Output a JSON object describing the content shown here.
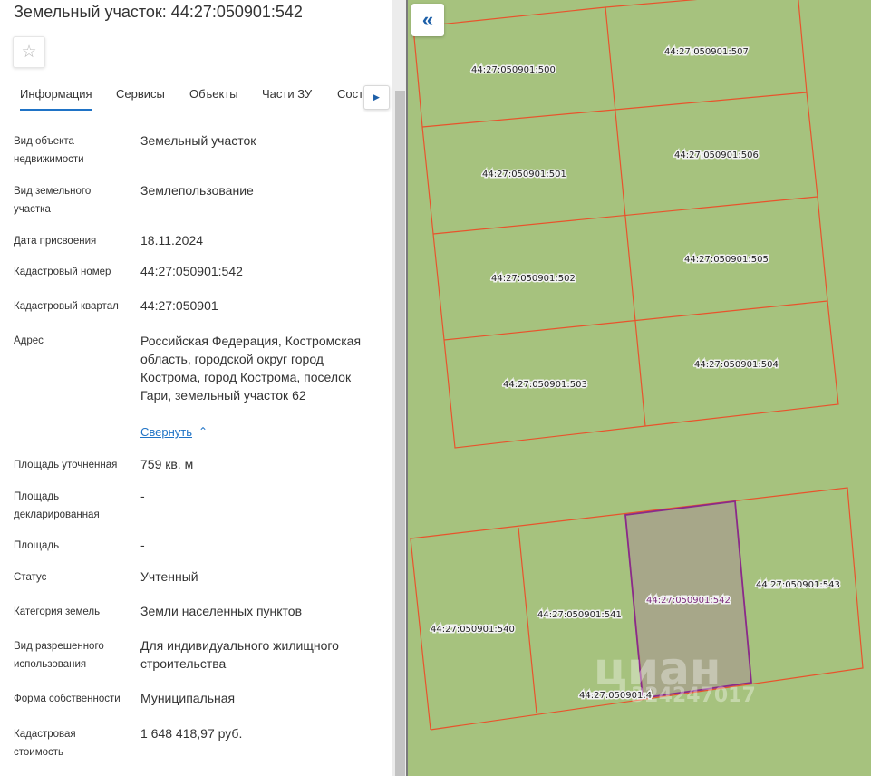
{
  "title": "Земельный участок: 44:27:050901:542",
  "tabs": [
    "Информация",
    "Сервисы",
    "Объекты",
    "Части ЗУ",
    "Состав"
  ],
  "fields": [
    {
      "label": "Вид объекта недвижимости",
      "value": "Земельный участок"
    },
    {
      "label": "Вид земельного участка",
      "value": "Землепользование"
    },
    {
      "label": "Дата присвоения",
      "value": "18.11.2024"
    },
    {
      "label": "Кадастровый номер",
      "value": "44:27:050901:542"
    },
    {
      "label": "Кадастровый квартал",
      "value": "44:27:050901"
    },
    {
      "label": "Адрес",
      "value": "Российская Федерация, Костромская область, городской округ город Кострома, город Кострома, поселок Гари, земельный участок 62"
    },
    {
      "label": "Площадь уточненная",
      "value": "759 кв. м"
    },
    {
      "label": "Площадь декларированная",
      "value": "-"
    },
    {
      "label": "Площадь",
      "value": "-"
    },
    {
      "label": "Статус",
      "value": "Учтенный"
    },
    {
      "label": "Категория земель",
      "value": "Земли населенных пунктов"
    },
    {
      "label": "Вид разрешенного использования",
      "value": "Для индивидуального жилищного строительства"
    },
    {
      "label": "Форма собственности",
      "value": "Муниципальная"
    },
    {
      "label": "Кадастровая стоимость",
      "value": "1 648 418,97 руб."
    }
  ],
  "collapse_label": "Свернуть",
  "map": {
    "parcels": [
      "44:27:050901:500",
      "44:27:050901:507",
      "44:27:050901:501",
      "44:27:050901:506",
      "44:27:050901:502",
      "44:27:050901:505",
      "44:27:050901:503",
      "44:27:050901:504",
      "44:27:050901:540",
      "44:27:050901:541",
      "44:27:050901:542",
      "44:27:050901:543",
      "44:27:050901:4"
    ],
    "watermark": "циан",
    "watermark_number": "324247017",
    "colors": {
      "ground": "#a6c27e",
      "boundary": "#e8532c",
      "selected": "#8a2a8a"
    }
  },
  "icons": {
    "favorite": "star-icon",
    "next": "chevron-right-icon",
    "collapse_panel": "double-chevron-left-icon",
    "collapse": "chevron-up-icon"
  }
}
